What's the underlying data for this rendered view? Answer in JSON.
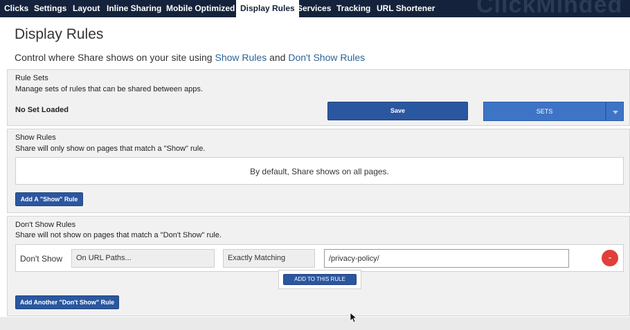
{
  "nav": {
    "tabs": [
      {
        "label": "Clicks"
      },
      {
        "label": "Settings"
      },
      {
        "label": "Layout"
      },
      {
        "label": "Inline Sharing"
      },
      {
        "label": "Mobile Optimized"
      },
      {
        "label": "Display Rules"
      },
      {
        "label": "Services"
      },
      {
        "label": "Tracking"
      },
      {
        "label": "URL Shortener"
      }
    ],
    "active_tab": "Display Rules",
    "brand": "ClickMinded"
  },
  "page": {
    "title": "Display Rules",
    "subtitle_prefix": "Control where Share shows on your site using ",
    "subtitle_link1": "Show Rules",
    "subtitle_middle": " and ",
    "subtitle_link2": "Don't Show Rules"
  },
  "rule_sets": {
    "title": "Rule Sets",
    "description": "Manage sets of rules that can be shared between apps.",
    "status": "No Set Loaded",
    "save_label": "Save",
    "sets_label": "SETS"
  },
  "show_rules": {
    "title": "Show Rules",
    "description": "Share will only show on pages that match a \"Show\" rule.",
    "default_message": "By default, Share shows on all pages.",
    "add_button": "Add A \"Show\" Rule"
  },
  "dont_show_rules": {
    "title": "Don't Show Rules",
    "description": "Share will not show on pages that match a \"Don't Show\" rule.",
    "rule": {
      "label": "Don't Show",
      "target": "On URL Paths...",
      "match": "Exactly Matching",
      "value": "/privacy-policy/",
      "remove_label": "-"
    },
    "add_to_rule": "ADD TO THIS RULE",
    "add_button": "Add Another \"Don't Show\" Rule"
  },
  "colors": {
    "nav_bg": "#14233b",
    "button_blue": "#2b57a0",
    "sets_blue": "#3e74c6",
    "remove_red": "#e0403a",
    "link": "#2a6496"
  }
}
